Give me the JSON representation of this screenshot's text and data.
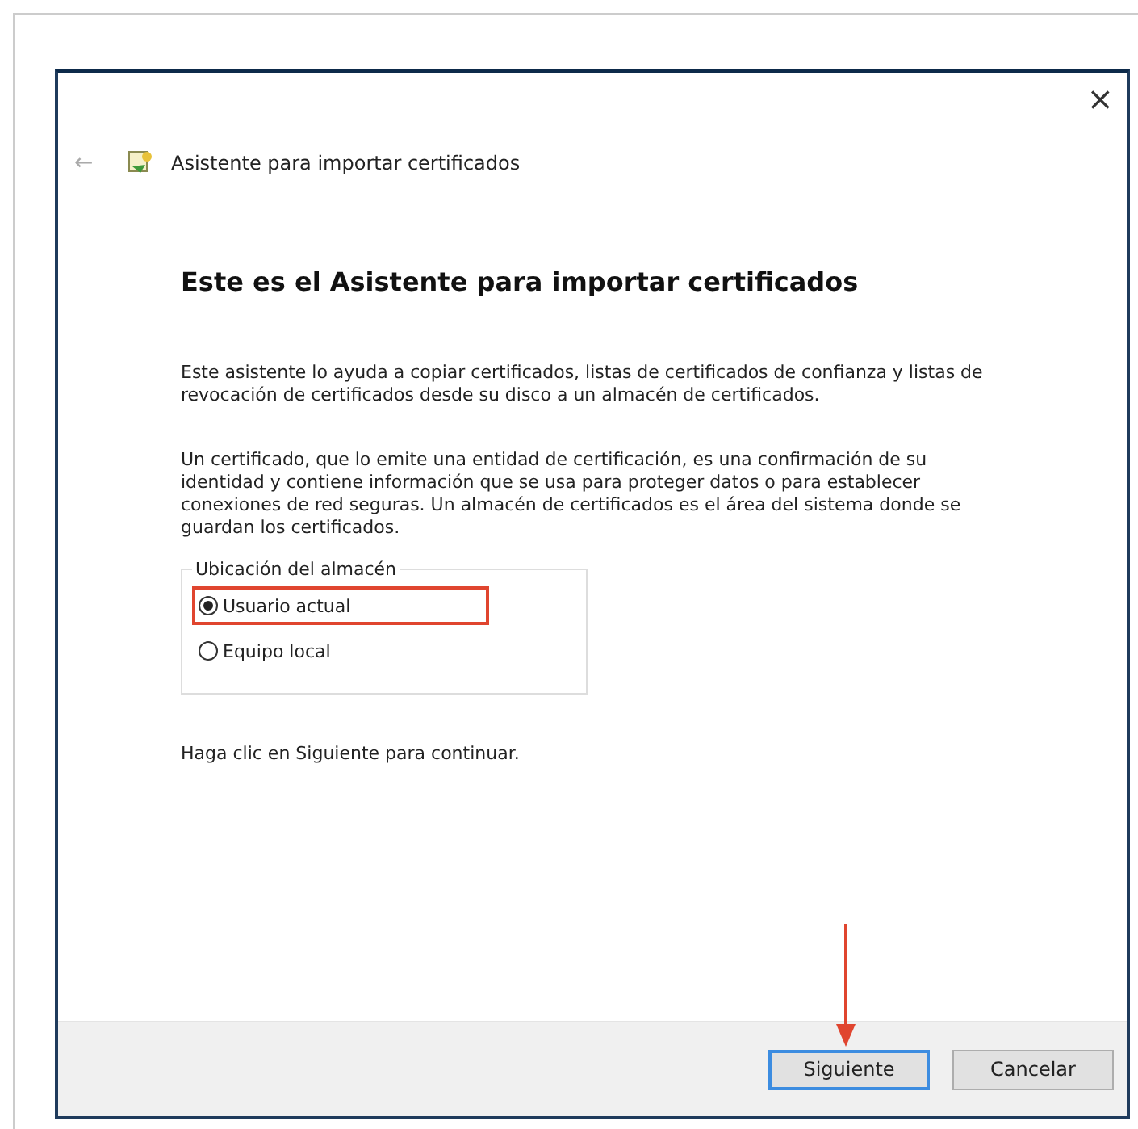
{
  "window": {
    "title": "Asistente para importar certificados",
    "close": "×",
    "back": "←"
  },
  "heading": "Este es el Asistente para importar certificados",
  "paragraphs": [
    "Este asistente lo ayuda a copiar certificados, listas de certificados de confianza y listas de revocación de certificados desde su disco a un almacén de certificados.",
    "Un certificado, que lo emite una entidad de certificación, es una confirmación de su identidad y contiene información que se usa para proteger datos o para establecer conexiones de red seguras. Un almacén de certificados es el área del sistema donde se guardan los certificados."
  ],
  "store_location": {
    "legend": "Ubicación del almacén",
    "options": [
      {
        "label": "Usuario actual",
        "selected": true,
        "highlighted": true
      },
      {
        "label": "Equipo local",
        "selected": false,
        "highlighted": false
      }
    ]
  },
  "hint": "Haga clic en Siguiente para continuar.",
  "buttons": [
    {
      "label": "Siguiente",
      "default": true,
      "arrow": true
    },
    {
      "label": "Cancelar",
      "default": false,
      "arrow": false
    }
  ]
}
